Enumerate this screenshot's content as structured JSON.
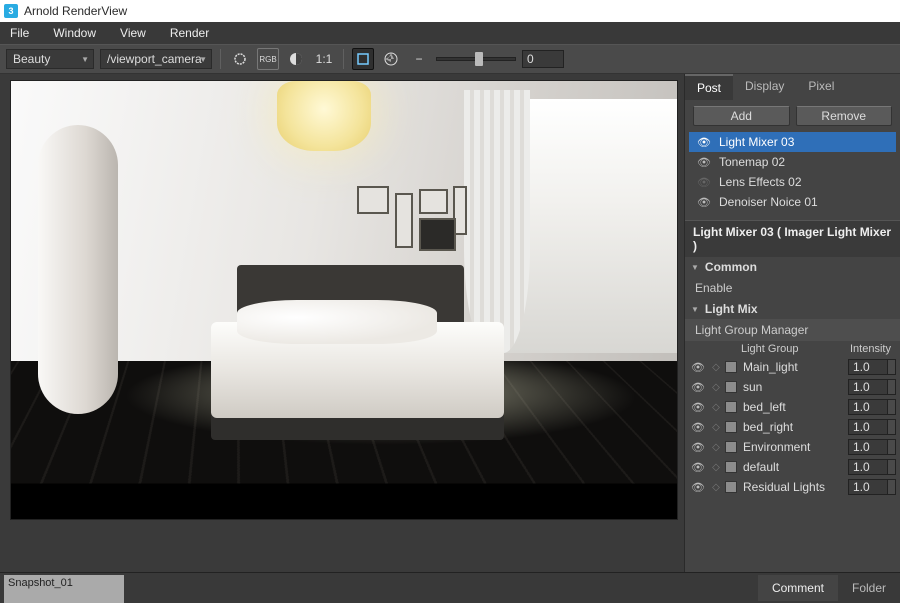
{
  "app": {
    "title": "Arnold RenderView"
  },
  "menu": [
    "File",
    "Window",
    "View",
    "Render"
  ],
  "toolbar": {
    "aov": "Beauty",
    "camera": "/viewport_camera",
    "ratio": "1:1",
    "exposure_value": "0"
  },
  "right": {
    "tabs": [
      "Post",
      "Display",
      "Pixel"
    ],
    "active_tab": 0,
    "buttons": {
      "add": "Add",
      "remove": "Remove"
    },
    "imagers": [
      {
        "label": "Light Mixer 03",
        "visible": true,
        "selected": true
      },
      {
        "label": "Tonemap 02",
        "visible": true,
        "selected": false
      },
      {
        "label": "Lens Effects 02",
        "visible": false,
        "selected": false
      },
      {
        "label": "Denoiser Noice 01",
        "visible": true,
        "selected": false
      }
    ],
    "selected_title": "Light Mixer 03  ( Imager Light Mixer )",
    "common": {
      "header": "Common",
      "enable": "Enable"
    },
    "lightmix": {
      "header": "Light Mix",
      "manager": "Light Group Manager",
      "col_group": "Light Group",
      "col_intensity": "Intensity",
      "rows": [
        {
          "name": "Main_light",
          "intensity": "1.0"
        },
        {
          "name": "sun",
          "intensity": "1.0"
        },
        {
          "name": "bed_left",
          "intensity": "1.0"
        },
        {
          "name": "bed_right",
          "intensity": "1.0"
        },
        {
          "name": "Environment",
          "intensity": "1.0"
        },
        {
          "name": "default",
          "intensity": "1.0"
        },
        {
          "name": "Residual Lights",
          "intensity": "1.0"
        }
      ]
    }
  },
  "bottom": {
    "snapshot": "Snapshot_01",
    "tabs": [
      "Comment",
      "Folder"
    ],
    "active_tab": 0
  }
}
